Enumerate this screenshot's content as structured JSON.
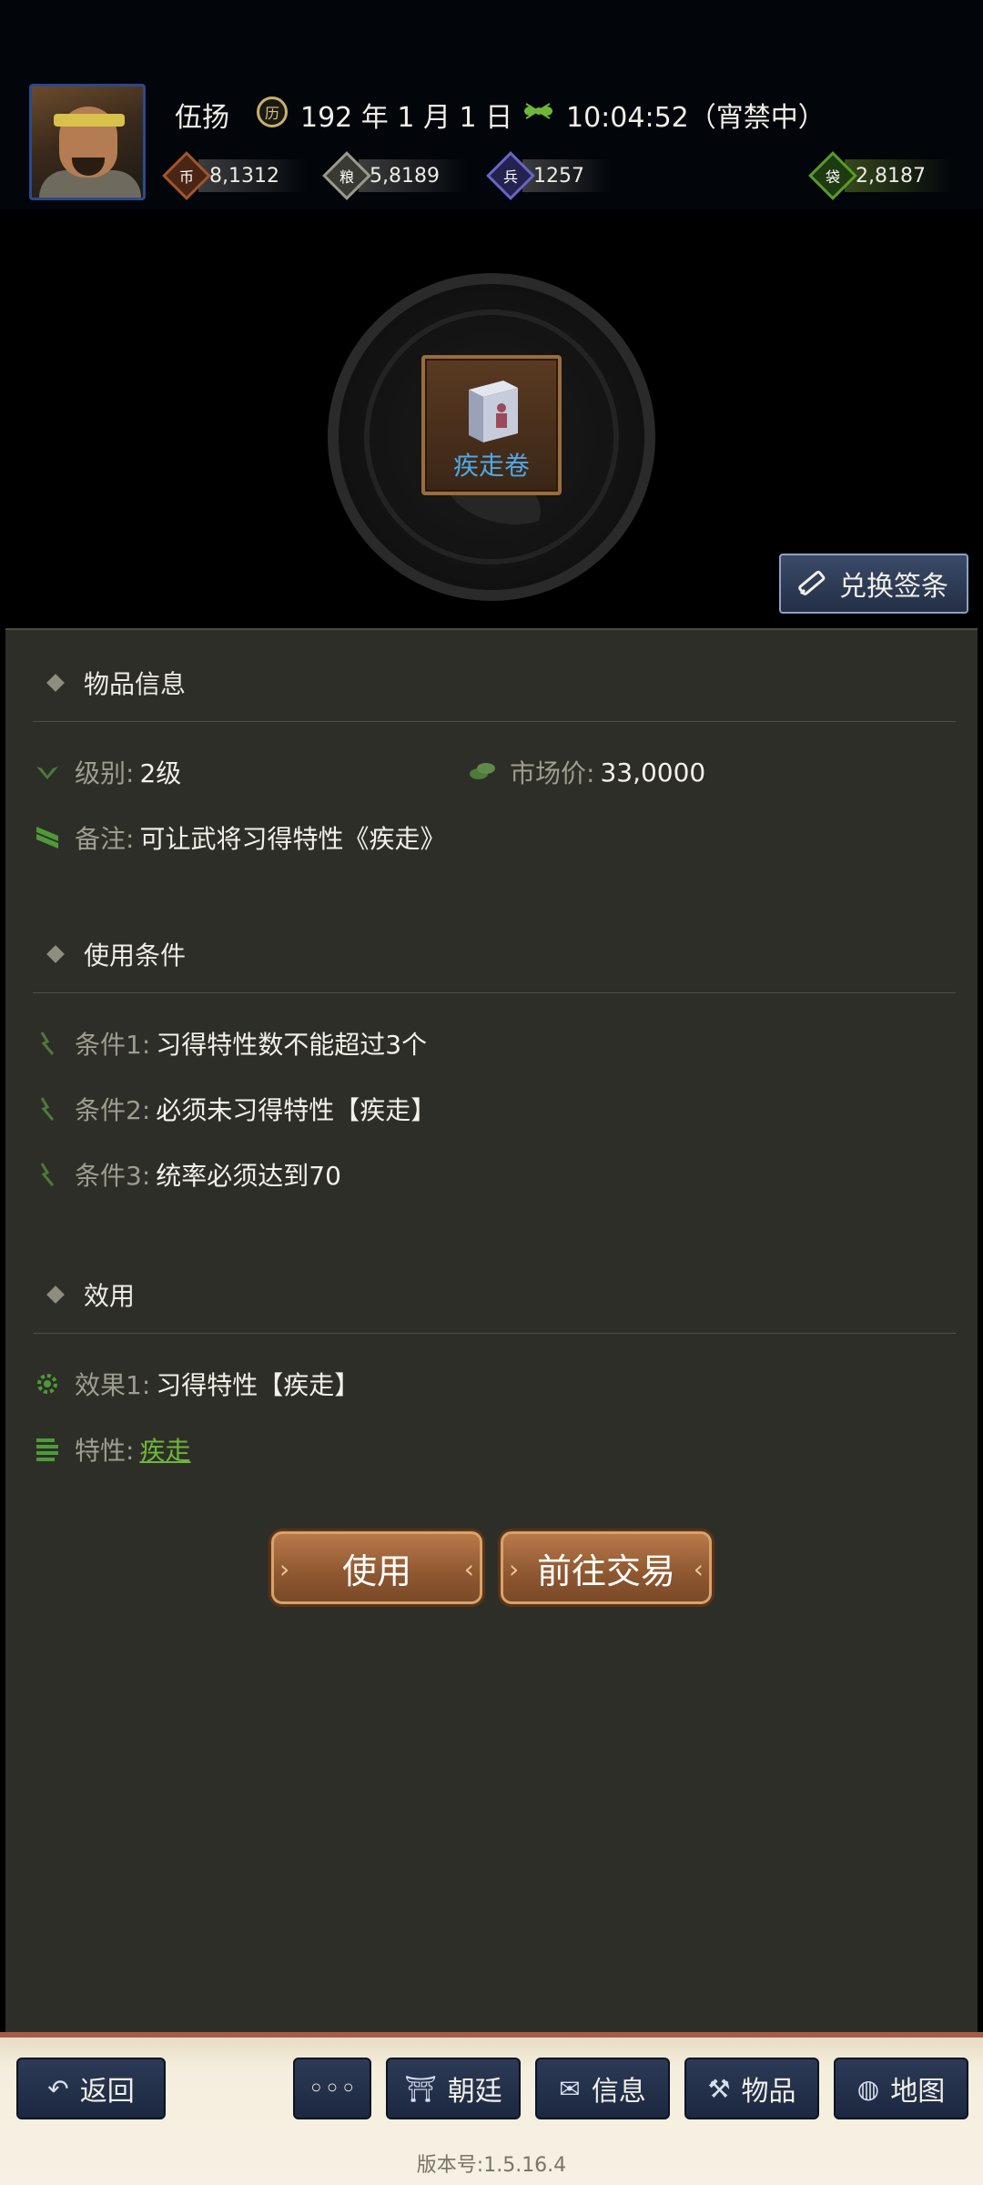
{
  "header": {
    "name": "伍扬",
    "date": "192 年 1 月 1 日",
    "time": "10:04:52（宵禁中）",
    "resources": [
      {
        "icon": "money-icon",
        "value": "8,1312",
        "color": "#a0552c"
      },
      {
        "icon": "grain-icon",
        "value": "5,8189",
        "color": "#9a9a8a"
      },
      {
        "icon": "soldier-icon",
        "value": "1257",
        "color": "#6a64c8"
      },
      {
        "icon": "bag-icon",
        "value": "2,8187",
        "color": "#5a9a2a"
      }
    ]
  },
  "item": {
    "name": "疾走卷"
  },
  "exchange_label": "兑换签条",
  "sections": {
    "info": {
      "title": "物品信息",
      "level_key": "级别:",
      "level_val": "2级",
      "price_key": "市场价:",
      "price_val": "33,0000",
      "note_key": "备注:",
      "note_val": "可让武将习得特性《疾走》"
    },
    "conditions": {
      "title": "使用条件",
      "items": [
        {
          "key": "条件1:",
          "val": "习得特性数不能超过3个"
        },
        {
          "key": "条件2:",
          "val": "必须未习得特性【疾走】"
        },
        {
          "key": "条件3:",
          "val": "统率必须达到70"
        }
      ]
    },
    "effect": {
      "title": "效用",
      "effect_key": "效果1:",
      "effect_val": "习得特性【疾走】",
      "trait_key": "特性:",
      "trait_val": "疾走"
    }
  },
  "actions": {
    "use": "使用",
    "trade": "前往交易"
  },
  "footer": {
    "back": "返回",
    "more": "◦◦◦",
    "court": "朝廷",
    "message": "信息",
    "items": "物品",
    "map": "地图",
    "version": "版本号:1.5.16.4"
  }
}
